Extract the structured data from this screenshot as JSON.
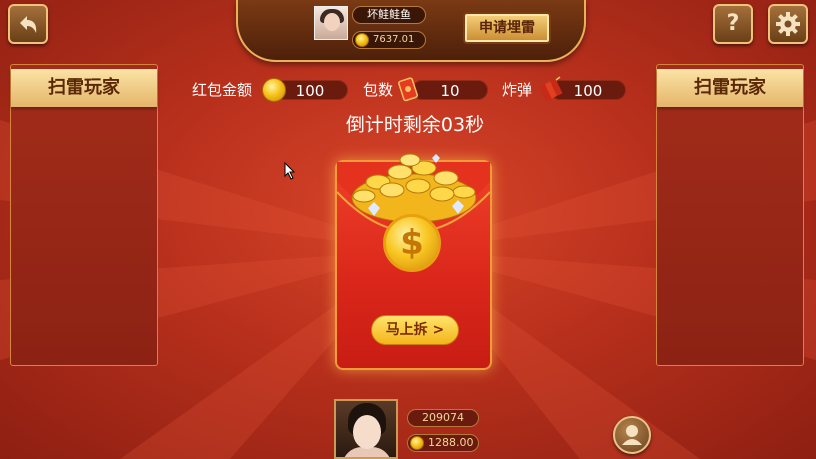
{
  "header": {
    "player_name": "坏鲑鲑鱼",
    "player_coins": "7637.01",
    "apply_button": "申请埋雷"
  },
  "top_buttons": {
    "help_label": "?"
  },
  "side_panels": {
    "left_title": "扫雷玩家",
    "right_title": "扫雷玩家"
  },
  "info": {
    "amount_label": "红包金额",
    "amount_value": "100",
    "count_label": "包数",
    "count_value": "10",
    "bomb_label": "炸弹",
    "bomb_value": "100"
  },
  "countdown": "倒计时剩余03秒",
  "envelope": {
    "coin_symbol": "$",
    "open_button": "马上拆 >"
  },
  "bottom": {
    "player_id": "209074",
    "player_coins": "1288.00"
  },
  "colors": {
    "background": "#b8301c",
    "gold": "#f7c31a",
    "panel_header": "#fbe3a6"
  }
}
